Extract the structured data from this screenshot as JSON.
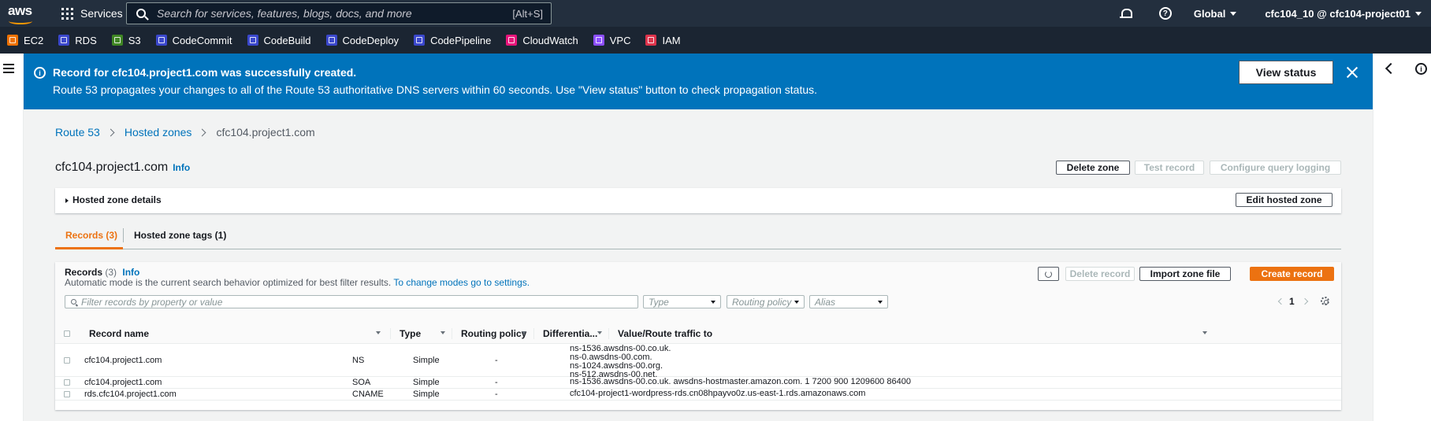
{
  "topnav": {
    "logo_text": "aws",
    "services_label": "Services",
    "search_placeholder": "Search for services, features, blogs, docs, and more",
    "search_shortcut": "[Alt+S]",
    "region": "Global",
    "account": "cfc104_10 @ cfc104-project01"
  },
  "favorites": [
    {
      "label": "EC2",
      "color": "#ed7100"
    },
    {
      "label": "RDS",
      "color": "#3b48cc"
    },
    {
      "label": "S3",
      "color": "#3f8624"
    },
    {
      "label": "CodeCommit",
      "color": "#3b48cc"
    },
    {
      "label": "CodeBuild",
      "color": "#3b48cc"
    },
    {
      "label": "CodeDeploy",
      "color": "#3b48cc"
    },
    {
      "label": "CodePipeline",
      "color": "#3b48cc"
    },
    {
      "label": "CloudWatch",
      "color": "#e7157b"
    },
    {
      "label": "VPC",
      "color": "#8c4fff"
    },
    {
      "label": "IAM",
      "color": "#dd344c"
    }
  ],
  "flash": {
    "title": "Record for cfc104.project1.com was successfully created.",
    "message": "Route 53 propagates your changes to all of the Route 53 authoritative DNS servers within 60 seconds. Use \"View status\" button to check propagation status.",
    "view_status": "View status"
  },
  "breadcrumb": {
    "root": "Route 53",
    "parent": "Hosted zones",
    "current": "cfc104.project1.com"
  },
  "page": {
    "title": "cfc104.project1.com",
    "info": "Info",
    "delete_zone": "Delete zone",
    "test_record": "Test record",
    "configure_logging": "Configure query logging"
  },
  "details": {
    "label": "Hosted zone details",
    "edit": "Edit hosted zone"
  },
  "tabs": {
    "records": "Records (3)",
    "tags": "Hosted zone tags (1)"
  },
  "records": {
    "title": "Records",
    "count": "(3)",
    "info": "Info",
    "desc": "Automatic mode is the current search behavior optimized for best filter results.",
    "desc_link": "To change modes go to settings.",
    "delete": "Delete record",
    "import": "Import zone file",
    "create": "Create record",
    "filter_placeholder": "Filter records by property or value",
    "type_select": "Type",
    "routing_select": "Routing policy",
    "alias_select": "Alias",
    "page": "1",
    "columns": {
      "name": "Record name",
      "type": "Type",
      "routing": "Routing policy",
      "diff": "Differentia...",
      "value": "Value/Route traffic to"
    },
    "rows": [
      {
        "name": "cfc104.project1.com",
        "type": "NS",
        "routing": "Simple",
        "diff": "-",
        "values": [
          "ns-1536.awsdns-00.co.uk.",
          "ns-0.awsdns-00.com.",
          "ns-1024.awsdns-00.org.",
          "ns-512.awsdns-00.net."
        ]
      },
      {
        "name": "cfc104.project1.com",
        "type": "SOA",
        "routing": "Simple",
        "diff": "-",
        "values": [
          "ns-1536.awsdns-00.co.uk. awsdns-hostmaster.amazon.com. 1 7200 900 1209600 86400"
        ]
      },
      {
        "name": "rds.cfc104.project1.com",
        "type": "CNAME",
        "routing": "Simple",
        "diff": "-",
        "values": [
          "cfc104-project1-wordpress-rds.cn08hpayvo0z.us-east-1.rds.amazonaws.com"
        ]
      }
    ]
  }
}
